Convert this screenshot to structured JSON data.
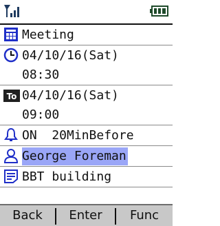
{
  "status": {
    "signal_icon": "signal-strength-icon",
    "battery_icon": "battery-icon"
  },
  "event": {
    "title": "Meeting",
    "start_date": "04/10/16(Sat)",
    "start_time": "08:30",
    "end_label": "To",
    "end_date": "04/10/16(Sat)",
    "end_time": "09:00",
    "alarm": "ON  20MinBefore",
    "contact": "George Foreman",
    "location": "BBT building"
  },
  "softkeys": {
    "left": "Back",
    "center": "Enter",
    "right": "Func"
  },
  "colors": {
    "highlight": "#9aa6f7",
    "icon_blue": "#1f2fc8",
    "softkey_bg": "#c8c8c8"
  }
}
